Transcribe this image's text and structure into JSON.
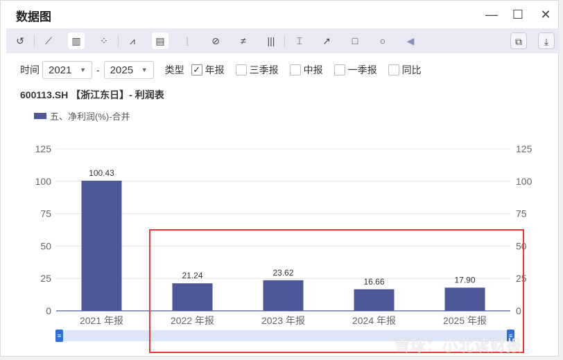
{
  "window": {
    "title": "数据图"
  },
  "filters": {
    "time_label": "时间",
    "from": "2021",
    "dash": "-",
    "to": "2025",
    "type_label": "类型",
    "options": [
      {
        "label": "年报",
        "checked": true
      },
      {
        "label": "三季报",
        "checked": false
      },
      {
        "label": "中报",
        "checked": false
      },
      {
        "label": "一季报",
        "checked": false
      },
      {
        "label": "同比",
        "checked": false
      }
    ]
  },
  "subtitle": "600113.SH 【浙江东日】- 利润表",
  "watermark": "雪球：小北读财报",
  "chart_data": {
    "type": "bar",
    "categories": [
      "2021 年报",
      "2022 年报",
      "2023 年报",
      "2024 年报",
      "2025 年报"
    ],
    "series": [
      {
        "name": "五、净利润(%)-合并",
        "values": [
          100.43,
          21.24,
          23.62,
          16.66,
          17.9
        ],
        "color": "#4e5797"
      }
    ],
    "value_labels": [
      "100.43",
      "21.24",
      "23.62",
      "16.66",
      "17.90"
    ],
    "ylim": [
      0,
      125
    ],
    "yticks": [
      "0",
      "25",
      "50",
      "75",
      "100",
      "125"
    ],
    "grid": true,
    "legend": "top-left"
  }
}
